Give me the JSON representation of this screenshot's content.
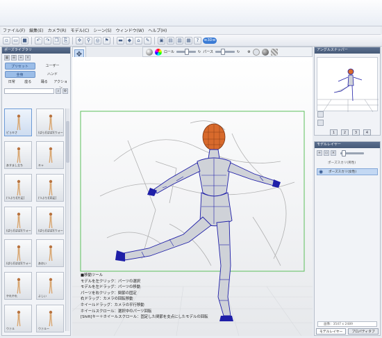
{
  "menubar": {
    "items": [
      "ファイル(F)",
      "編集(E)",
      "カメラ(R)",
      "モデル(C)",
      "シーン(S)",
      "ウィンドウ(W)",
      "ヘルプ(H)"
    ]
  },
  "toolbar": {
    "icons": [
      "new-file-icon",
      "open-file-icon",
      "save-icon",
      "undo-icon",
      "redo-icon",
      "copy-icon",
      "paste-icon",
      "light-icon",
      "joint-icon",
      "target-icon",
      "pin-icon",
      "ruler-icon",
      "palette-icon",
      "measure-icon",
      "pen-icon",
      "view-a-icon",
      "view-b-icon",
      "view-c-icon",
      "view-d-icon",
      "help-icon"
    ],
    "pill_label": "≪3D≫"
  },
  "library": {
    "title": "ポーズライブラリ",
    "tabs": [
      "プリセット",
      "ユーザー"
    ],
    "subtabs_row1": [
      "全身",
      "ハンド"
    ],
    "subtabs_row2": [
      "日常",
      "座る",
      "踊る",
      "アクション"
    ],
    "poses": [
      {
        "label": "ピョキさ"
      },
      {
        "label": "(ばら)[ぱぱ](ウォー"
      },
      {
        "label": "あすまし立ち"
      },
      {
        "label": "キャ"
      },
      {
        "label": "(つぶり)[片足]"
      },
      {
        "label": "(つぶり)[両足]"
      },
      {
        "label": "(ぱら)[ぱぱ](ウォー"
      },
      {
        "label": "(ぱら)[ぱぱ](ウォー"
      },
      {
        "label": "(ぱら)[ぱぱ](ウォー"
      },
      {
        "label": "あおい"
      },
      {
        "label": "やれやれ"
      },
      {
        "label": "よしい"
      },
      {
        "label": "ウァル"
      },
      {
        "label": "ウァルー"
      }
    ]
  },
  "camera_bar": {
    "roll_label": "ロール",
    "perspective_label": "パース"
  },
  "viewport": {
    "help_lines": [
      "■移動ツール",
      "モデルを左クリック：パーツの選択",
      "モデルを左ドラッグ：パーツの移動",
      "パーツを右クリック：関節の固定",
      "右ドラッグ：カメラの回転移動",
      "ホイールドラッグ：カメラの平行移動",
      "ホイールスクロール：選択中のパーツ回転",
      "[Shift]キー＋ホイールスクロール：固定した関節を支点にしたモデルの回転"
    ]
  },
  "angle_panel": {
    "title": "アングルスナッパー",
    "buttons": [
      "1",
      "2",
      "3",
      "4"
    ]
  },
  "layer_panel": {
    "title": "モデルレイヤー",
    "layers": [
      "ポーズスカリ(男性)",
      "ポーズスカリ(女性)"
    ],
    "canvas_size": "画像：3547 x 2489",
    "tabs": [
      "モデルレイヤー",
      "プロパティタブ"
    ]
  },
  "colors": {
    "accent": "#3a7bd5",
    "panel_header": "#4e6382",
    "model_wire": "#1f1fa8",
    "head_orange": "#d86a2c",
    "canvas_frame": "#5bbf5b"
  }
}
